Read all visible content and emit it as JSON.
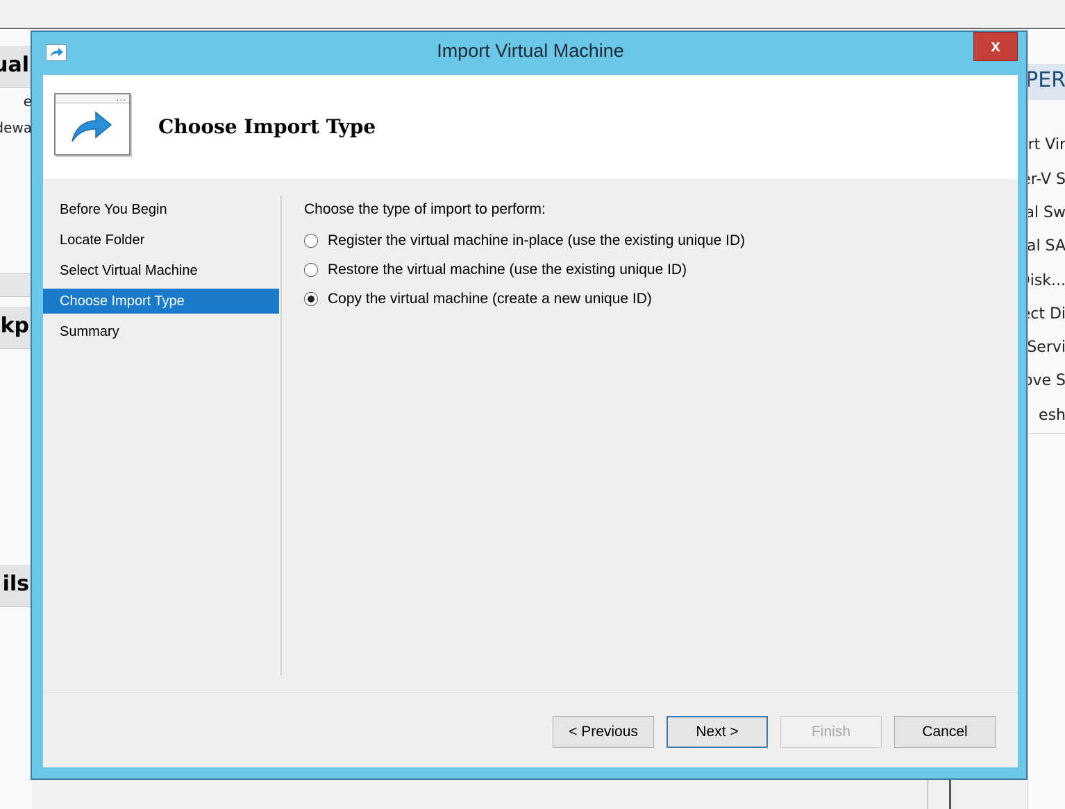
{
  "background": {
    "left_panel": {
      "header_top_fragment": "ual",
      "rows": [
        "e",
        "dewa"
      ],
      "header_mid_fragment": "ckp",
      "header_bottom_fragment": "ils"
    },
    "right_panel": {
      "header_fragment": "YPER",
      "actions": [
        "ort Vir",
        "er-V S",
        "al Sw",
        "al SA",
        "Disk...",
        "ect Di",
        "Servi",
        "ove S",
        "esh"
      ]
    }
  },
  "dialog": {
    "title": "Import Virtual Machine",
    "close_label": "x",
    "header_title": "Choose Import Type",
    "steps": [
      "Before You Begin",
      "Locate Folder",
      "Select Virtual Machine",
      "Choose Import Type",
      "Summary"
    ],
    "active_step_index": 3,
    "prompt": "Choose the type of import to perform:",
    "options": [
      {
        "label": "Register the virtual machine in-place (use the existing unique ID)",
        "selected": false
      },
      {
        "label": "Restore the virtual machine (use the existing unique ID)",
        "selected": false
      },
      {
        "label": "Copy the virtual machine (create a new unique ID)",
        "selected": true
      }
    ],
    "buttons": {
      "previous": "< Previous",
      "next": "Next >",
      "finish": "Finish",
      "cancel": "Cancel"
    }
  },
  "colors": {
    "frame": "#6ac7e8",
    "close": "#c6403a",
    "active_step": "#1979ca",
    "arrow": "#2a8fd6"
  },
  "icons": [
    "import-arrow-icon",
    "close-icon",
    "wizard-window-icon"
  ]
}
